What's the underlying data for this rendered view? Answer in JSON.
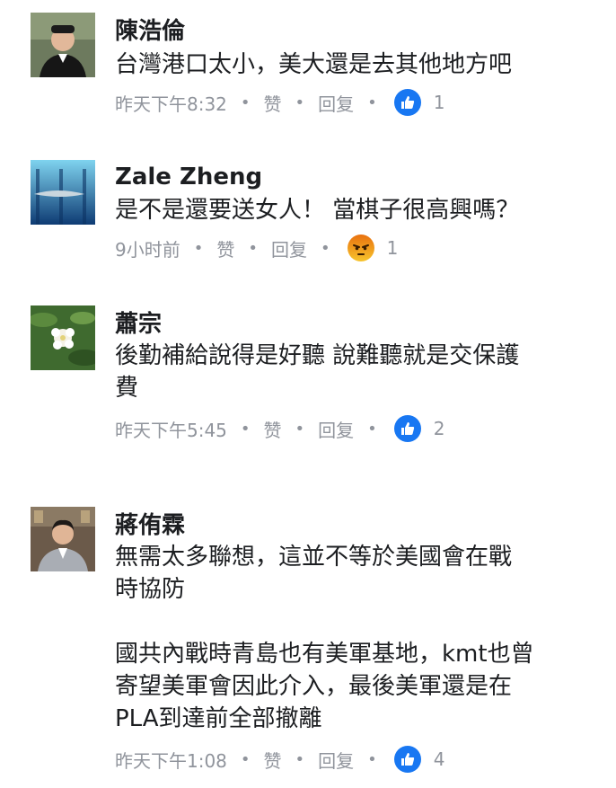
{
  "comments": [
    {
      "name": "陳浩倫",
      "lines": [
        "台灣港口太小，美大還是去其他地方吧"
      ],
      "time": "昨天下午8:32",
      "like": "赞",
      "reply": "回复",
      "reaction_icon": "like-icon",
      "reaction_count": "1"
    },
    {
      "name": "Zale Zheng",
      "lines": [
        "是不是還要送女人！ 當棋子很高興嗎？"
      ],
      "time": "9小时前",
      "like": "赞",
      "reply": "回复",
      "reaction_icon": "angry-face-icon",
      "reaction_count": "1"
    },
    {
      "name": "蕭宗",
      "lines": [
        "後勤補給說得是好聽 說難聽就是交保護",
        "費"
      ],
      "time": "昨天下午5:45",
      "like": "赞",
      "reply": "回复",
      "reaction_icon": "like-icon",
      "reaction_count": "2"
    },
    {
      "name": "蔣侑霖",
      "lines": [
        "無需太多聯想，這並不等於美國會在戰",
        "時協防",
        "",
        "國共內戰時青島也有美軍基地，kmt也曾",
        "寄望美軍會因此介入，最後美軍還是在",
        "PLA到達前全部撤離"
      ],
      "time": "昨天下午1:08",
      "like": "赞",
      "reply": "回复",
      "reaction_icon": "like-icon",
      "reaction_count": "4"
    }
  ],
  "colors": {
    "name": "#1c1e21",
    "meta": "#90949c",
    "like_blue": "#1877f2"
  }
}
